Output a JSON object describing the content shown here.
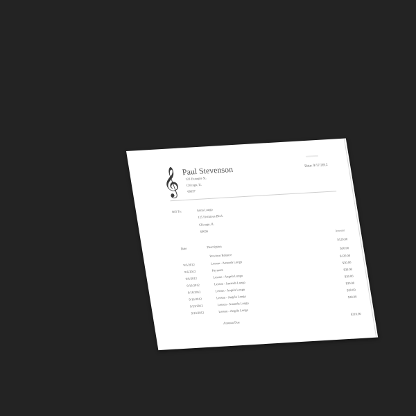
{
  "sender": {
    "name": "Paul Stevenson",
    "address": [
      "123 Example St.",
      "Chicago, IL",
      "60637"
    ]
  },
  "date_label": "Date: 9/17/2012",
  "bill_to": {
    "label": "Bill To:",
    "lines": [
      "Anna Longo",
      "125 Fictitious Blvd.",
      "Chicago, IL",
      "60636"
    ]
  },
  "columns": {
    "date": "Date",
    "description": "Description",
    "amount_header": "Amount",
    "amount_first": "$120.00"
  },
  "rows": [
    {
      "date": "",
      "description": "Previous Balance",
      "amount": "$30.00"
    },
    {
      "date": "9/3/2012",
      "description": "Lesson - Amanda Longo",
      "amount": "$120.00"
    },
    {
      "date": "9/6/2012",
      "description": "Payment",
      "amount": "$30.00"
    },
    {
      "date": "9/8/2012",
      "description": "Lesson - Angela Longo",
      "amount": "$30.00"
    },
    {
      "date": "9/10/2012",
      "description": "Lesson - Amanda Longo",
      "amount": "$30.00"
    },
    {
      "date": "9/16/2012",
      "description": "Lesson - Angela Longo",
      "amount": "$30.00"
    },
    {
      "date": "9/16/2012",
      "description": "Lesson - Angela Longo",
      "amount": "$30.00"
    },
    {
      "date": "9/23/2012",
      "description": "Lesson - Amanda Longo",
      "amount": "$30.00"
    },
    {
      "date": "9/23/2012",
      "description": "Lesson - Angela Longo",
      "amount": ""
    }
  ],
  "amount_due": {
    "label": "Amount Due",
    "value": "$210.00"
  },
  "icons": {
    "logo": "treble-clef-icon"
  }
}
